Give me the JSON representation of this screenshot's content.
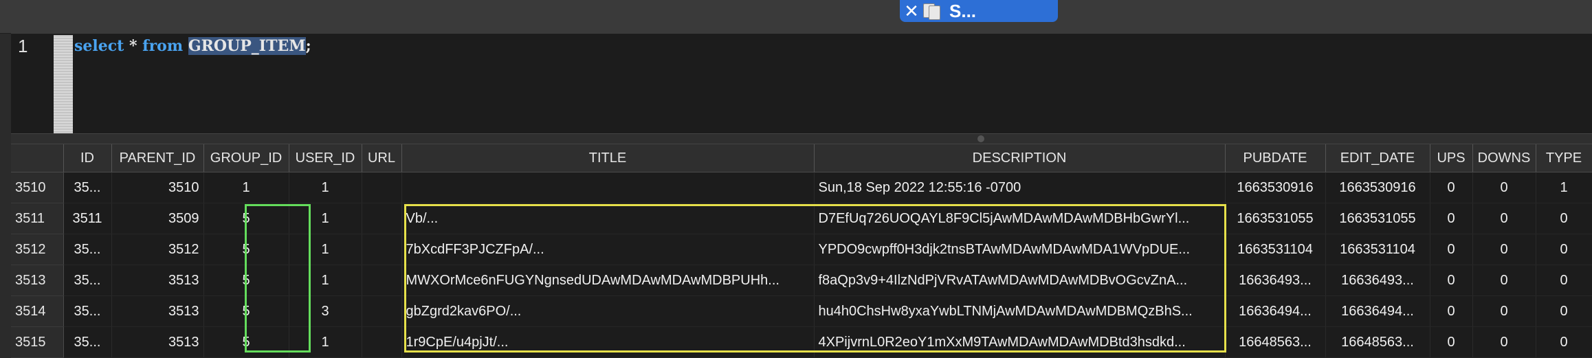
{
  "tab": {
    "close_glyph": "✕",
    "label": "S..."
  },
  "editor": {
    "line_number": "1",
    "tokens": {
      "select": "select",
      "star": " * ",
      "from": "from",
      "space": " ",
      "table": "GROUP_ITEM",
      "semi": ";"
    }
  },
  "columns": [
    "",
    "ID",
    "PARENT_ID",
    "GROUP_ID",
    "USER_ID",
    "URL",
    "TITLE",
    "DESCRIPTION",
    "PUBDATE",
    "EDIT_DATE",
    "UPS",
    "DOWNS",
    "TYPE"
  ],
  "rows": [
    [
      "3510",
      "35...",
      "3510",
      "1",
      "1",
      "",
      "",
      "Sun,18 Sep 2022 12:55:16 -0700",
      "1663530916",
      "1663530916",
      "0",
      "0",
      "1"
    ],
    [
      "3511",
      "3511",
      "3509",
      "5",
      "1",
      "",
      "Vb/...",
      "D7EfUq726UOQAYL8F9Cl5jAwMDAwMDAwMDBHbGwrYl...",
      "1663531055",
      "1663531055",
      "0",
      "0",
      "0"
    ],
    [
      "3512",
      "35...",
      "3512",
      "5",
      "1",
      "",
      "7bXcdFF3PJCZFpA/...",
      "YPDO9cwpff0H3djk2tnsBTAwMDAwMDAwMDA1WVpDUE...",
      "1663531104",
      "1663531104",
      "0",
      "0",
      "0"
    ],
    [
      "3513",
      "35...",
      "3513",
      "5",
      "1",
      "",
      "MWXOrMce6nFUGYNgnsedUDAwMDAwMDAwMDBPUHh...",
      "f8aQp3v9+4IlzNdPjVRvATAwMDAwMDAwMDBvOGcvZnA...",
      "16636493...",
      "16636493...",
      "0",
      "0",
      "0"
    ],
    [
      "3514",
      "35...",
      "3513",
      "5",
      "3",
      "",
      "gbZgrd2kav6PO/...",
      "hu4h0ChsHw8yxaYwbLTNMjAwMDAwMDAwMDBMQzBhS...",
      "16636494...",
      "16636494...",
      "0",
      "0",
      "0"
    ],
    [
      "3515",
      "35...",
      "3513",
      "5",
      "1",
      "",
      "1r9CpE/u4pjJt/...",
      "4XPijvrnL0R2eoY1mXxM9TAwMDAwMDAwMDBtd3hsdkd...",
      "16648563...",
      "16648563...",
      "0",
      "0",
      "0"
    ]
  ],
  "colors": {
    "tab": "#2d6fd6",
    "keyword": "#4aa3f0",
    "green_highlight": "#64dd5c",
    "yellow_highlight": "#e6e04a"
  }
}
